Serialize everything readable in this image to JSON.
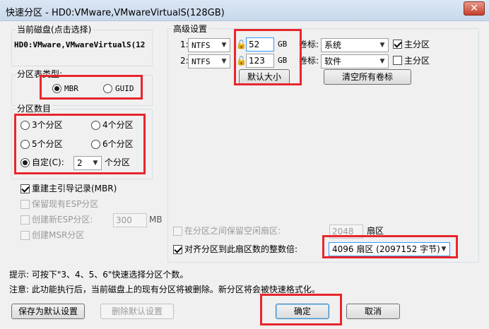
{
  "window": {
    "title": "快速分区 - HD0:VMware,VMwareVirtualS(128GB)",
    "close_label": "✕"
  },
  "current_disk": {
    "group_label": "当前磁盘(点击选择)",
    "value": "HD0:VMware,VMwareVirtualS(12"
  },
  "partition_type": {
    "group_label": "分区表类型:",
    "options": [
      {
        "label": "MBR",
        "checked": true
      },
      {
        "label": "GUID",
        "checked": false
      }
    ]
  },
  "partition_count": {
    "group_label": "分区数目",
    "options": [
      {
        "label": "3个分区",
        "checked": false
      },
      {
        "label": "4个分区",
        "checked": false
      },
      {
        "label": "5个分区",
        "checked": false
      },
      {
        "label": "6个分区",
        "checked": false
      }
    ],
    "custom_label": "自定(C):",
    "custom_checked": true,
    "custom_value": "2",
    "custom_suffix": "个分区"
  },
  "options": {
    "rebuild_mbr": {
      "label": "重建主引导记录(MBR)",
      "checked": true
    },
    "keep_esp": {
      "label": "保留现有ESP分区",
      "checked": false
    },
    "create_esp": {
      "label": "创建新ESP分区:",
      "checked": false,
      "size": "300",
      "unit": "MB"
    },
    "create_msr": {
      "label": "创建MSR分区",
      "checked": false
    }
  },
  "advanced": {
    "group_label": "高级设置",
    "partitions": [
      {
        "index": "1:",
        "fs": "NTFS",
        "size": "52",
        "unit": "GB",
        "volume_label_caption": "卷标:",
        "volume_label": "系统",
        "primary_label": "主分区",
        "primary_checked": true
      },
      {
        "index": "2:",
        "fs": "NTFS",
        "size": "123",
        "unit": "GB",
        "volume_label_caption": "卷标:",
        "volume_label": "软件",
        "primary_label": "主分区",
        "primary_checked": false
      }
    ],
    "default_size_button": "默认大小",
    "clear_labels_button": "清空所有卷标",
    "free_sector": {
      "label": "在分区之间保留空闲扇区:",
      "checked": false,
      "value": "2048",
      "unit": "扇区"
    },
    "align": {
      "label": "对齐分区到此扇区数的整数倍:",
      "checked": true,
      "value": "4096 扇区 (2097152 字节)"
    }
  },
  "hints": {
    "line1": "提示: 可按下\"3、4、5、6\"快速选择分区个数。",
    "line2": "注意: 此功能执行后，当前磁盘上的现有分区将被删除。新分区将会被快速格式化。"
  },
  "buttons": {
    "save_default": "保存为默认设置",
    "delete_default": "删除默认设置",
    "ok": "确定",
    "cancel": "取消"
  },
  "colors": {
    "highlight_border": "#e8262c",
    "focus_border": "#3399ff"
  }
}
